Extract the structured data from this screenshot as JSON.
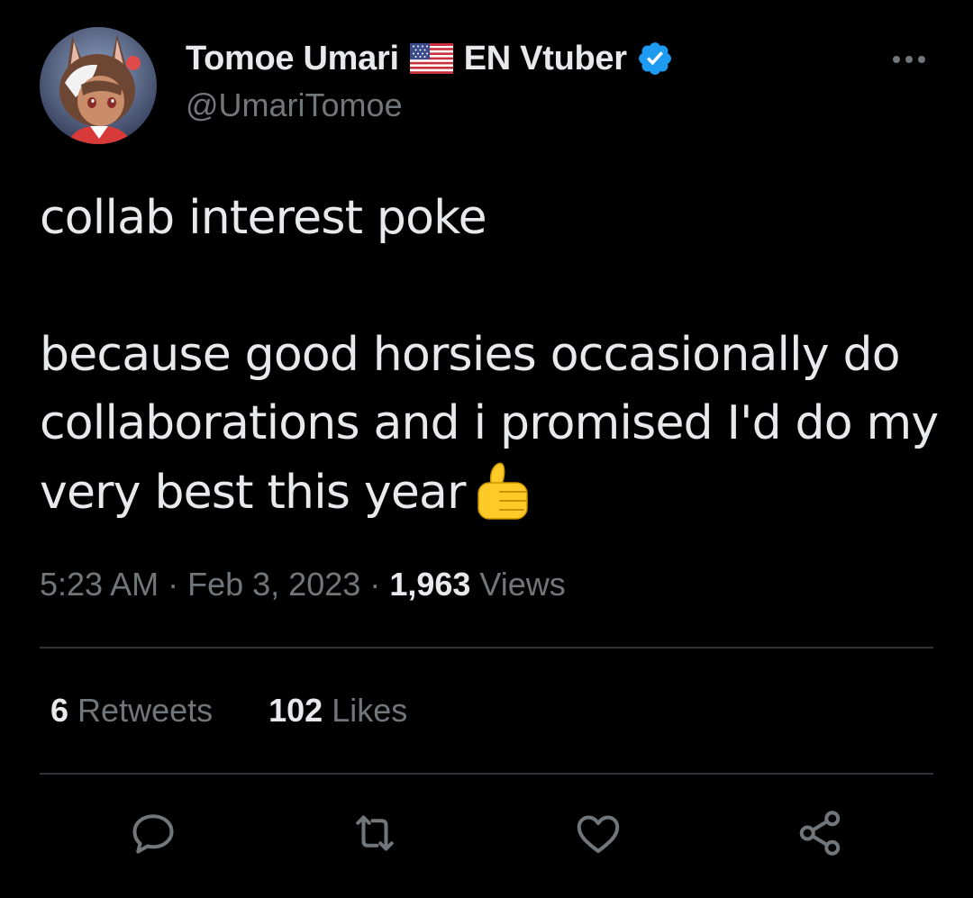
{
  "author": {
    "display_name": "Tomoe Umari",
    "display_name_suffix": "EN Vtuber",
    "handle": "@UmariTomoe",
    "avatar_icon": "avatar-image",
    "flag_icon": "us-flag-emoji",
    "verified_icon": "verified-badge-icon"
  },
  "tweet": {
    "paragraphs": [
      "collab interest poke",
      "because good horsies occasionally do collaborations and i promised I'd do my very best this year"
    ],
    "emoji": "thumbs-up-emoji"
  },
  "meta": {
    "time": "5:23 AM",
    "separator": "·",
    "date": "Feb 3, 2023",
    "views_count": "1,963",
    "views_label": "Views"
  },
  "stats": {
    "retweets_count": "6",
    "retweets_label": "Retweets",
    "likes_count": "102",
    "likes_label": "Likes"
  },
  "actions": {
    "reply_icon": "reply-icon",
    "retweet_icon": "retweet-icon",
    "like_icon": "heart-icon",
    "share_icon": "share-icon",
    "more_icon": "more-options-icon"
  },
  "colors": {
    "background": "#000000",
    "text_primary": "#e7e9ea",
    "text_secondary": "#71767b",
    "divider": "#2f3336",
    "verified_blue": "#1d9bf0"
  }
}
